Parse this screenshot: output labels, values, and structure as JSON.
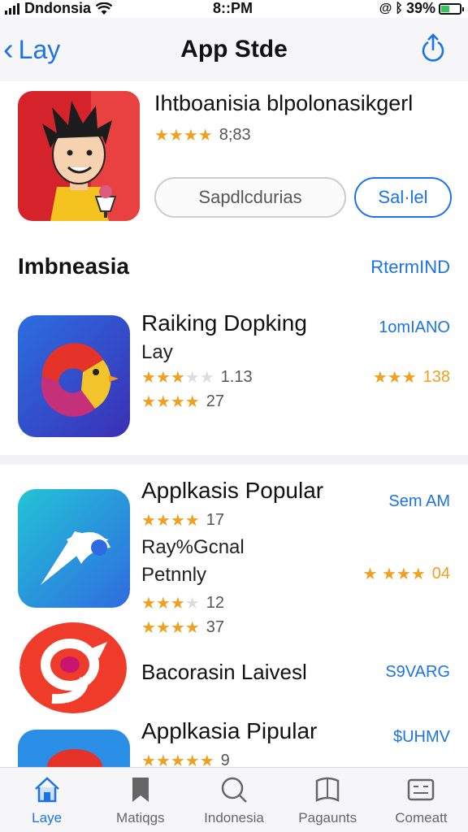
{
  "status_bar": {
    "carrier": "Dndonsia",
    "time": "8::PM",
    "battery_text": "39%",
    "icons": [
      "signal-icon",
      "wifi-icon",
      "location-icon",
      "bluetooth-icon",
      "battery-icon"
    ]
  },
  "nav": {
    "back_label": "Lay",
    "title": "App Stde",
    "share_icon": "share-icon"
  },
  "featured": {
    "title": "Ihtboanisia blpolonasikgerl",
    "stars": "★★★★",
    "rating": "8;83",
    "button_secondary": "Sapdlcdurias",
    "button_primary": "Sal·lel"
  },
  "section": {
    "title": "Imbneasia",
    "link": "RtermIND"
  },
  "apps": [
    {
      "title": "Raiking Dopking",
      "subtitle": "Lay",
      "rating1_stars": "★★★",
      "rating1_dim": "★★",
      "rating1_value": "1.13",
      "rating2_stars": "★★★★",
      "rating2_value": "27",
      "right_label": "1omIANO",
      "right_stars": "★★★",
      "right_value": "138"
    },
    {
      "title": "Applkasis Popular",
      "stars": "★★★★",
      "rating": "17",
      "subtitle1": "Ray%Gcnal",
      "subtitle2": "Petnnly",
      "rating2_stars": "★★★",
      "rating2_dim": "★",
      "rating2_value": "12",
      "rating3_stars": "★★★★",
      "rating3_value": "37",
      "right_label": "Sem AM",
      "right_stars": "★ ★★★",
      "right_value": "04"
    },
    {
      "title": "Bacorasin Laivesl",
      "right_label": "S9VARG"
    },
    {
      "title": "Applkasia Pipular",
      "stars": "★★★★★",
      "rating": "9",
      "right_label": "$UHMV"
    }
  ],
  "tabs": [
    {
      "label": "Laye",
      "icon": "home-icon"
    },
    {
      "label": "Matiqgs",
      "icon": "bookmark-icon"
    },
    {
      "label": "Indonesia",
      "icon": "search-icon"
    },
    {
      "label": "Pagaunts",
      "icon": "tag-icon"
    },
    {
      "label": "Comeatt",
      "icon": "card-icon"
    }
  ],
  "colors": {
    "accent": "#1a73e8",
    "star": "#f0a020",
    "battery": "#34c759"
  }
}
